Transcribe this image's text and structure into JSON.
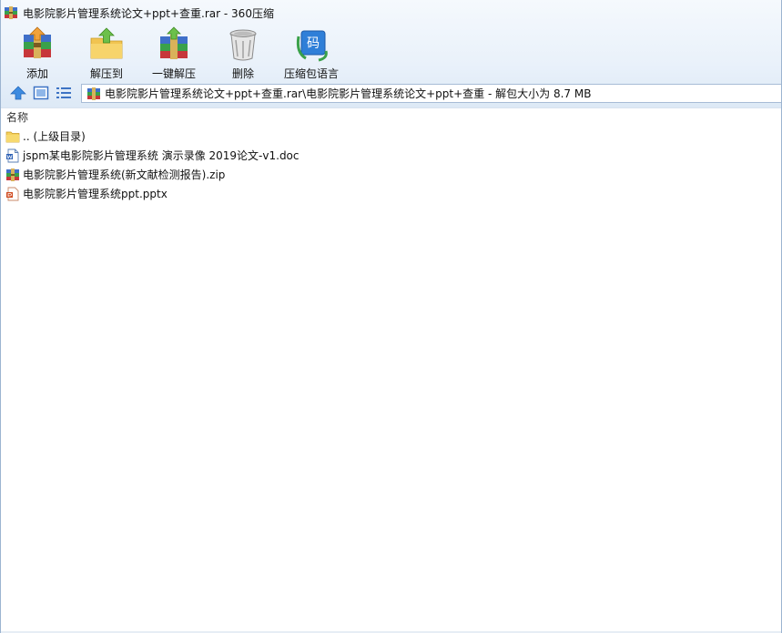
{
  "window": {
    "title": "电影院影片管理系统论文+ppt+查重.rar - 360压缩"
  },
  "toolbar": {
    "buttons": [
      {
        "label": "添加",
        "icon": "add-archive-icon"
      },
      {
        "label": "解压到",
        "icon": "extract-to-icon"
      },
      {
        "label": "一键解压",
        "icon": "one-click-extract-icon"
      },
      {
        "label": "删除",
        "icon": "delete-trash-icon"
      },
      {
        "label": "压缩包语言",
        "icon": "archive-language-icon"
      }
    ],
    "language_icon_glyph": "码"
  },
  "address": {
    "path": "电影院影片管理系统论文+ppt+查重.rar\\电影院影片管理系统论文+ppt+查重 - 解包大小为 8.7 MB"
  },
  "columns": {
    "name": "名称"
  },
  "files": [
    {
      "name": ".. (上级目录)",
      "type": "folder-up",
      "icon": "folder-icon"
    },
    {
      "name": "jspm某电影院影片管理系统 演示录像 2019论文-v1.doc",
      "type": "doc",
      "icon": "word-doc-icon"
    },
    {
      "name": "电影院影片管理系统(新文献检测报告).zip",
      "type": "zip",
      "icon": "zip-archive-icon"
    },
    {
      "name": "电影院影片管理系统ppt.pptx",
      "type": "pptx",
      "icon": "powerpoint-icon"
    }
  ],
  "colors": {
    "header_bg": "#e9f1fa",
    "accent_blue": "#2f7fd8",
    "folder_yellow": "#f3cf5a",
    "ppt_orange": "#d04a1f"
  }
}
